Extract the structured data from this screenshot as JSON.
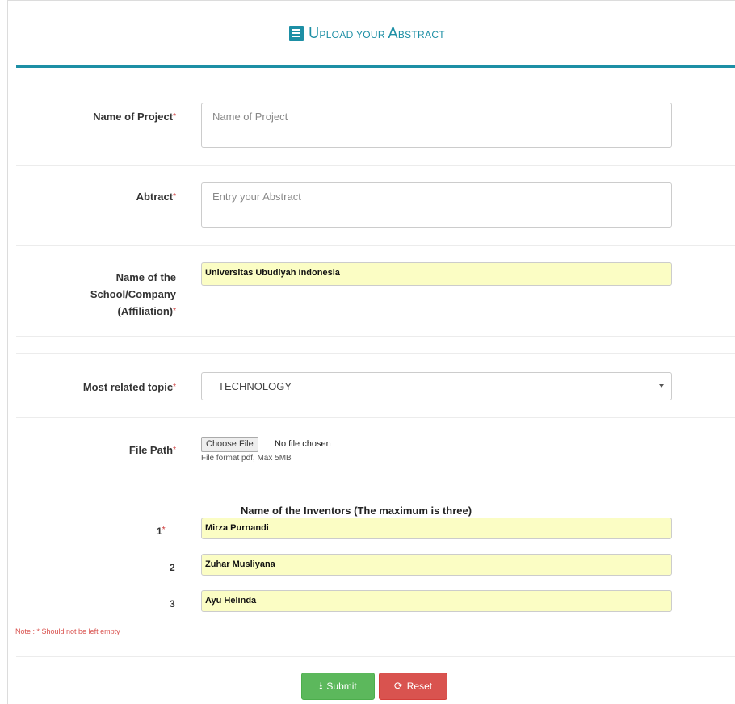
{
  "header": {
    "title_first": "U",
    "title_rest": "pload your ",
    "title_second": "A",
    "title_rest2": "bstract"
  },
  "form": {
    "project": {
      "label": "Name of Project",
      "placeholder": "Name of Project"
    },
    "abstract": {
      "label": "Abtract",
      "placeholder": "Entry your Abstract"
    },
    "school": {
      "label_1": "Name of the",
      "label_2": "School/Company",
      "label_3": "(Affiliation)",
      "value": "Universitas Ubudiyah Indonesia"
    },
    "topic": {
      "label": "Most related topic",
      "value": "TECHNOLOGY"
    },
    "file": {
      "label": "File Path",
      "button": "Choose File",
      "status": "No file chosen",
      "hint": "File format pdf, Max 5MB"
    },
    "inventors": {
      "heading": "Name of the Inventors (The maximum is three)",
      "rows": [
        {
          "num": "1",
          "required": true,
          "value": "Mirza Purnandi"
        },
        {
          "num": "2",
          "required": false,
          "value": "Zuhar Musliyana"
        },
        {
          "num": "3",
          "required": false,
          "value": "Ayu Helinda"
        }
      ]
    },
    "required_mark": "*",
    "note": "Note : * Should not be left empty"
  },
  "actions": {
    "submit": "Submit",
    "reset": "Reset"
  },
  "colors": {
    "accent": "#1d8fa5",
    "input_fill": "#fbfdc4",
    "submit": "#5cb85c",
    "reset": "#d9534f"
  }
}
